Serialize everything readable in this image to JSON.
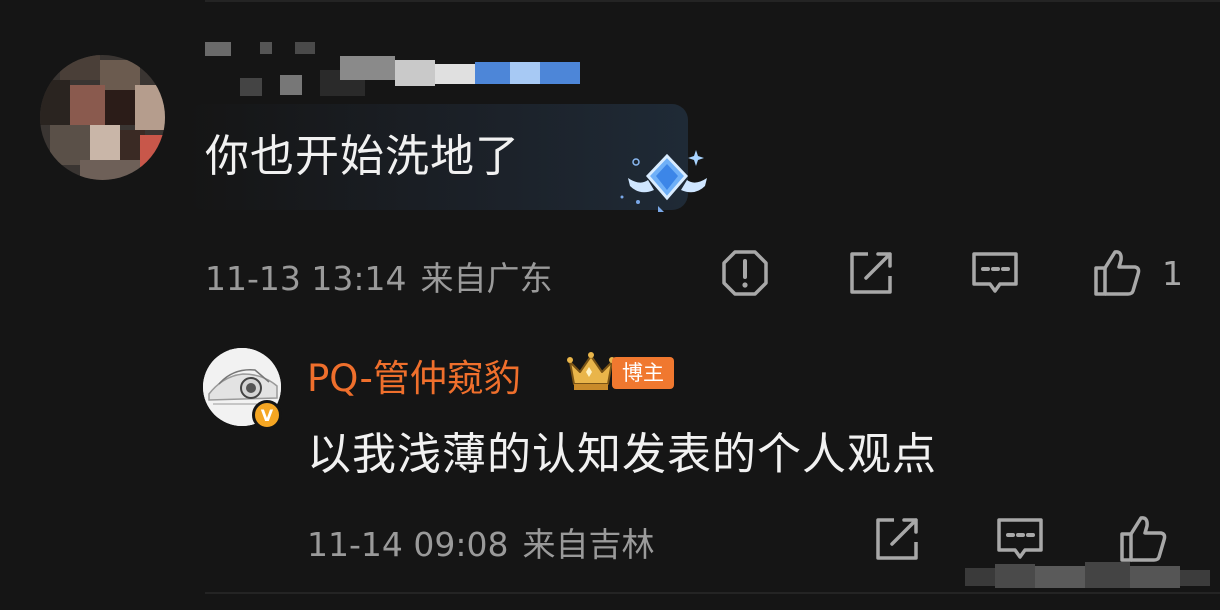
{
  "comments": [
    {
      "text": "你也开始洗地了",
      "time": "11-13 13:14",
      "location": "来自广东",
      "like_count": "1"
    }
  ],
  "reply": {
    "username": "PQ-管仲窥豹",
    "tag": "博主",
    "text": "以我浅薄的认知发表的个人观点",
    "time": "11-14 09:08",
    "location": "来自吉林"
  },
  "icons": [
    "report-icon",
    "repost-icon",
    "comment-icon",
    "like-icon",
    "diamond-badge-icon",
    "crown-badge-icon",
    "verified-icon"
  ],
  "colors": {
    "background": "#151515",
    "username_accent": "#ef6f2c",
    "tag_bg": "#f0782f",
    "meta_text": "#9a9a9a"
  }
}
